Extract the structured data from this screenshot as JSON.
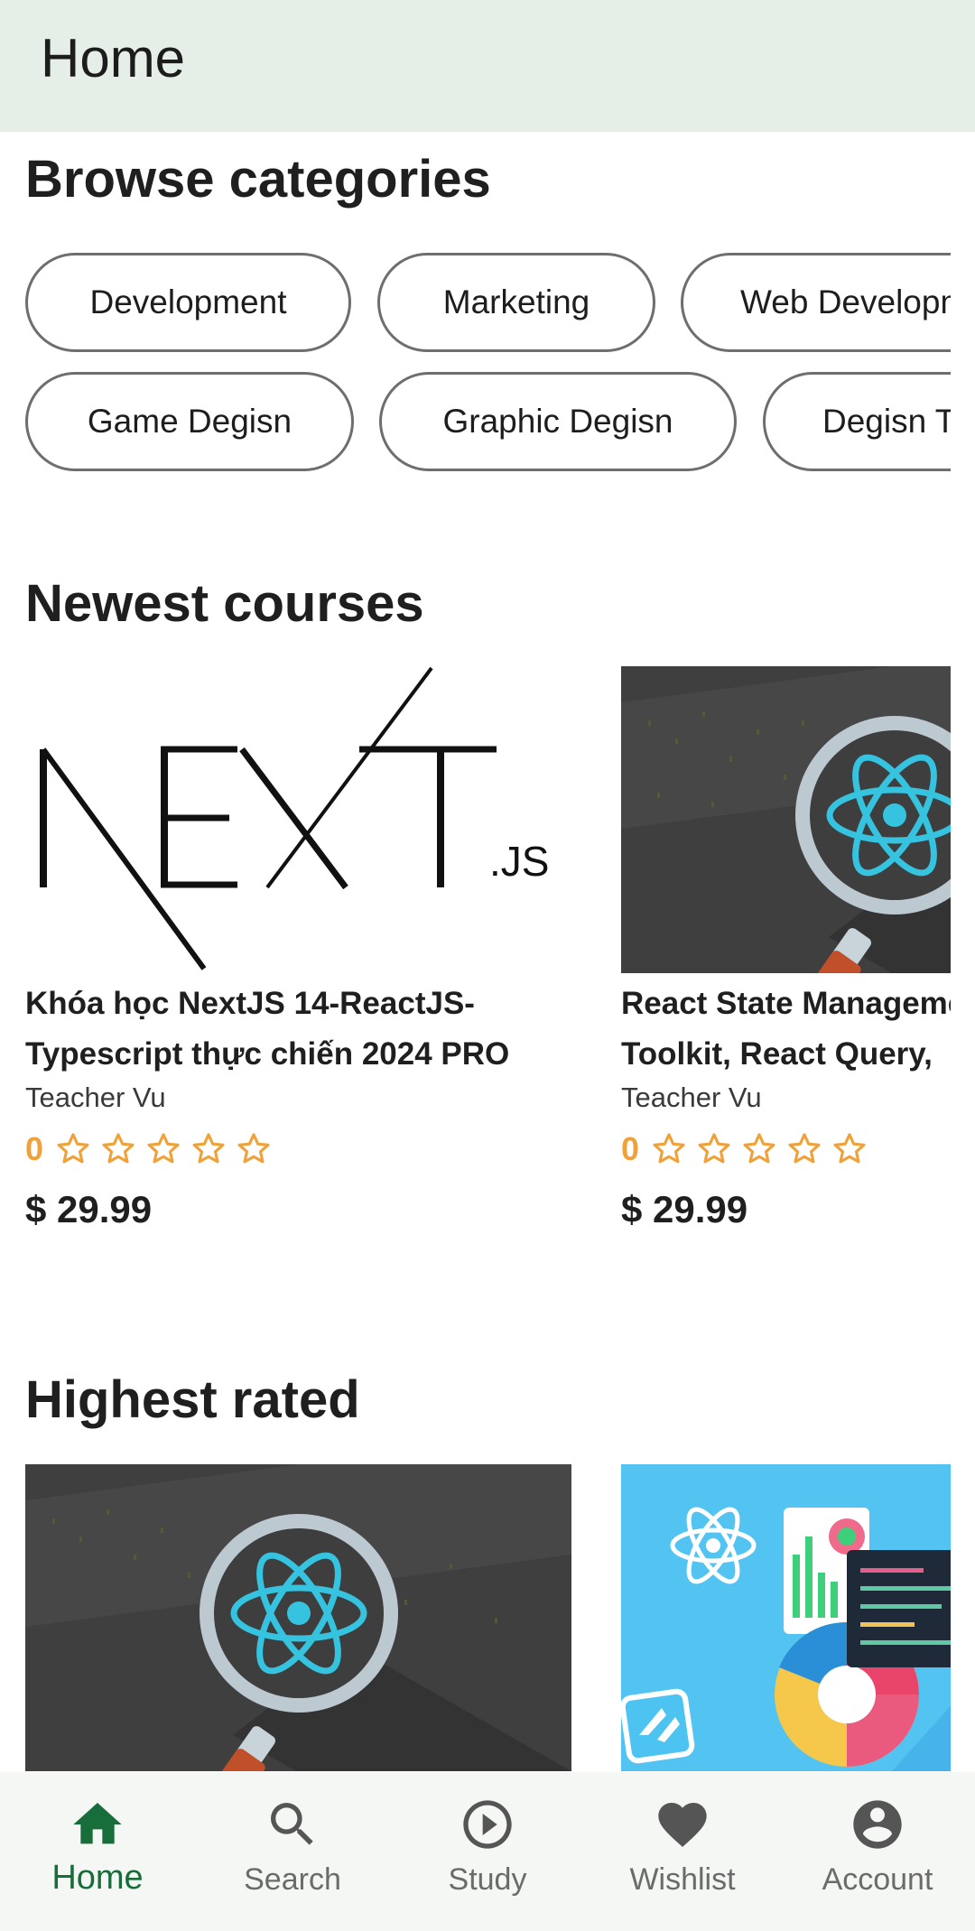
{
  "appbar": {
    "title": "Home"
  },
  "sections": {
    "categories_title": "Browse categories",
    "newest_title": "Newest courses",
    "highest_title": "Highest rated"
  },
  "categories": {
    "row1": [
      "Development",
      "Marketing",
      "Web Development"
    ],
    "row2": [
      "Game Degisn",
      "Graphic Degisn",
      "Degisn Tools"
    ]
  },
  "newest": [
    {
      "title_line1": "Khóa học NextJS 14-ReactJS-",
      "title_line2": "Typescript thực chiến 2024 PRO",
      "teacher": "Teacher Vu",
      "rating": "0",
      "stars": 0,
      "price": "$ 29.99",
      "thumb": {
        "logo_main": "NEXT",
        "logo_sub": ".JS"
      }
    },
    {
      "title_line1": "React State Management",
      "title_line2": "Toolkit, React Query,",
      "teacher": "Teacher Vu",
      "rating": "0",
      "stars": 0,
      "price": "$ 29.99",
      "thumb": {
        "type": "react-magnifier"
      }
    }
  ],
  "highest": [
    {
      "thumb": {
        "type": "react-magnifier"
      }
    },
    {
      "thumb": {
        "type": "react-dashboard"
      }
    }
  ],
  "nav": {
    "items": [
      {
        "label": "Home",
        "icon": "home-icon",
        "active": true
      },
      {
        "label": "Search",
        "icon": "search-icon",
        "active": false
      },
      {
        "label": "Study",
        "icon": "play-circle-icon",
        "active": false
      },
      {
        "label": "Wishlist",
        "icon": "heart-icon",
        "active": false
      },
      {
        "label": "Account",
        "icon": "account-circle-icon",
        "active": false
      }
    ]
  },
  "colors": {
    "appbar_bg": "#e6efe7",
    "active_green": "#186e3a",
    "star_orange": "#f0a23a",
    "nav_bg": "#f4f7f3"
  }
}
